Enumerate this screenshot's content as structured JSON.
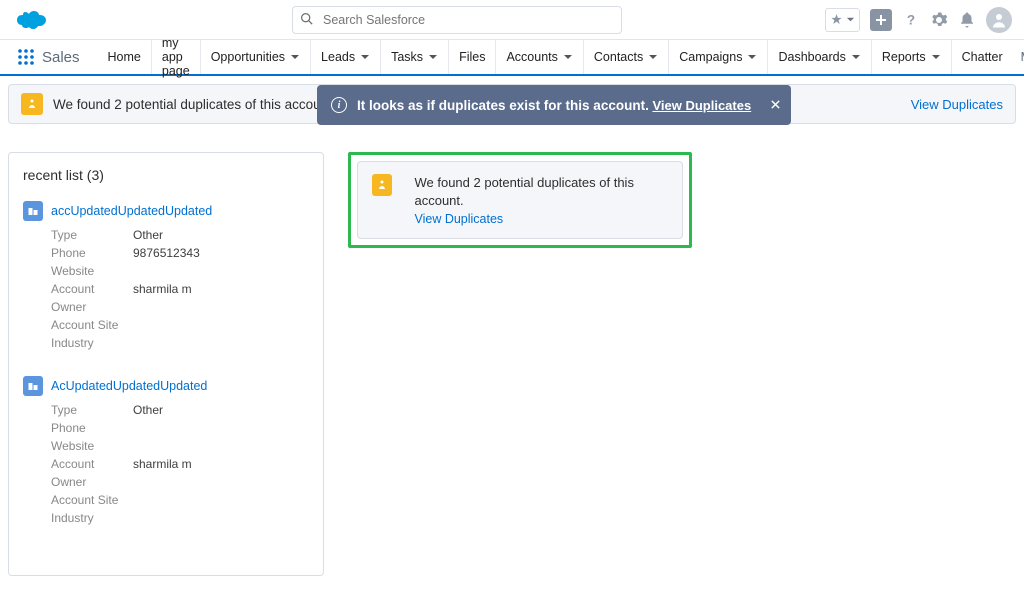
{
  "header": {
    "search_placeholder": "Search Salesforce"
  },
  "nav": {
    "app_label": "Sales",
    "items": [
      {
        "label": "Home",
        "menu": false
      },
      {
        "label": "my app page",
        "menu": false
      },
      {
        "label": "Opportunities",
        "menu": true
      },
      {
        "label": "Leads",
        "menu": true
      },
      {
        "label": "Tasks",
        "menu": true
      },
      {
        "label": "Files",
        "menu": false
      },
      {
        "label": "Accounts",
        "menu": true
      },
      {
        "label": "Contacts",
        "menu": true
      },
      {
        "label": "Campaigns",
        "menu": true
      },
      {
        "label": "Dashboards",
        "menu": true
      },
      {
        "label": "Reports",
        "menu": true
      },
      {
        "label": "Chatter",
        "menu": false
      }
    ],
    "more_label": "More"
  },
  "page_alert": {
    "text": "We found 2 potential duplicates of this account.",
    "right_link": "View Duplicates"
  },
  "toast": {
    "text": "It looks as if duplicates exist for this account.",
    "link": "View Duplicates"
  },
  "recent": {
    "title": "recent list (3)",
    "items": [
      {
        "name": "accUpdatedUpdatedUpdated",
        "fields": {
          "Type": "Other",
          "Phone": "9876512343",
          "Website": "",
          "Account Owner": "sharmila m",
          "Account Site": "",
          "Industry": ""
        }
      },
      {
        "name": "AcUpdatedUpdatedUpdated",
        "fields": {
          "Type": "Other",
          "Phone": "",
          "Website": "",
          "Account Owner": "sharmila m",
          "Account Site": "",
          "Industry": ""
        }
      }
    ]
  },
  "dup_card": {
    "text": "We found 2 potential duplicates of this account.",
    "link": "View Duplicates"
  },
  "field_labels": {
    "type": "Type",
    "phone": "Phone",
    "website": "Website",
    "owner": "Account Owner",
    "site": "Account Site",
    "industry": "Industry"
  }
}
